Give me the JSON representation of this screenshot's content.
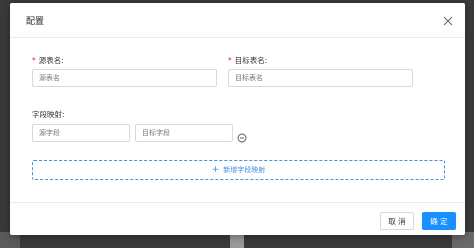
{
  "modal": {
    "title": "配置",
    "close_icon": "close-icon"
  },
  "form": {
    "source_table": {
      "label": "源表名:",
      "placeholder": "源表名",
      "required": true
    },
    "target_table": {
      "label": "目标表名:",
      "placeholder": "目标表名",
      "required": true
    },
    "field_mapping": {
      "label": "字段映射:",
      "source_field_placeholder": "源字段",
      "target_field_placeholder": "目标字段",
      "remove_icon": "minus-circle-icon"
    },
    "add_mapping_label": "新增字段映射",
    "add_icon": "plus-icon"
  },
  "footer": {
    "cancel_label": "取 消",
    "ok_label": "确 定"
  },
  "colors": {
    "primary": "#1890ff",
    "required": "#f5222d",
    "dashed_border": "#4a90e2"
  }
}
